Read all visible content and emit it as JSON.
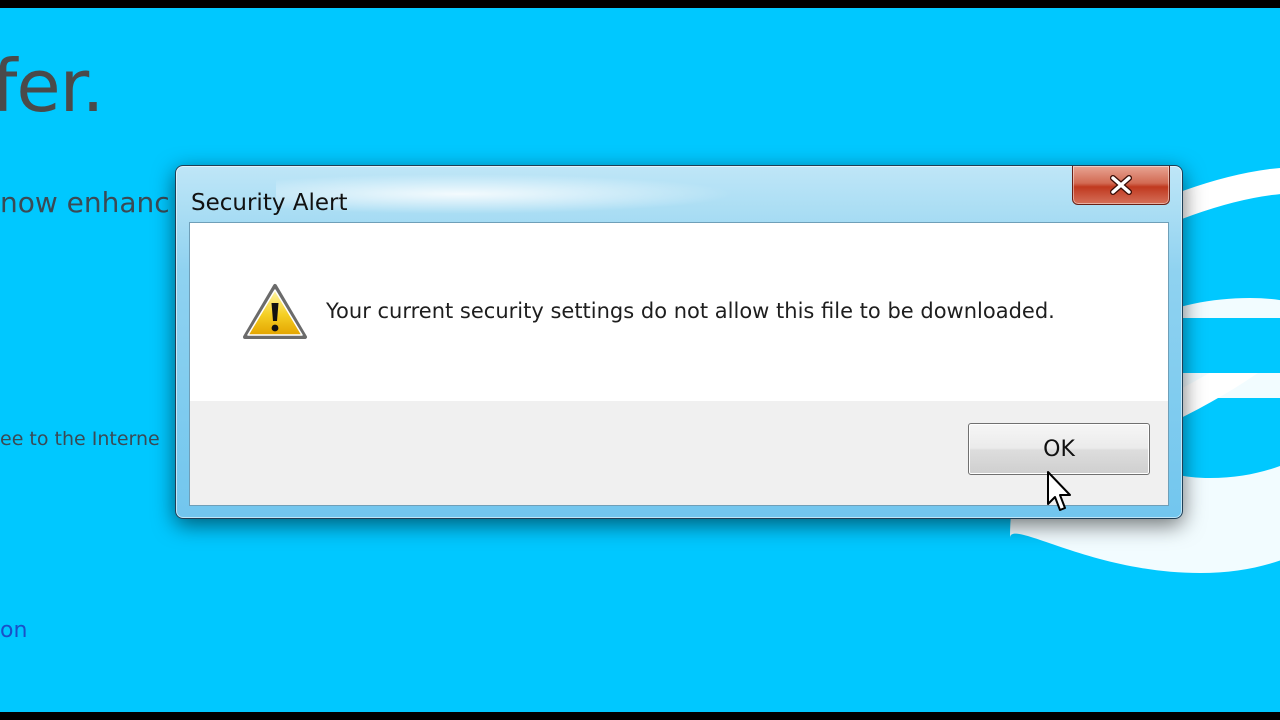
{
  "background_page": {
    "heading_fragment": "fer.",
    "subtitle_fragment": "now enhanc",
    "body_fragment": "ee to the Interne",
    "link_fragment": "on",
    "logo_icon": "internet-explorer-logo-icon"
  },
  "dialog": {
    "title": "Security Alert",
    "close_icon": "close-icon",
    "warning_icon": "warning-triangle-icon",
    "message": "Your current security settings do not allow this file to be downloaded.",
    "ok_label": "OK"
  },
  "cursor_icon": "mouse-pointer-icon",
  "colors": {
    "background": "#00c8ff",
    "title_bar": "#8fd2f0",
    "close_button": "#c0391f",
    "footer": "#f0f0f0"
  }
}
